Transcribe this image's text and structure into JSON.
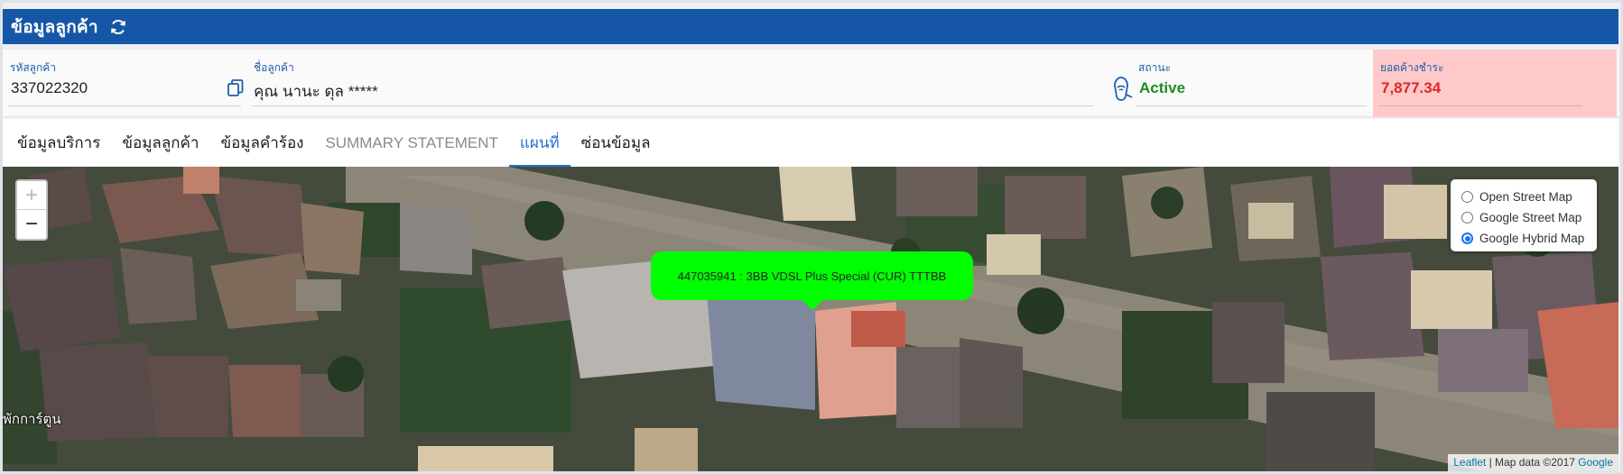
{
  "header": {
    "title": "ข้อมูลลูกค้า",
    "refresh_icon": "refresh-icon"
  },
  "customer": {
    "id_label": "รหัสลูกค้า",
    "id_value": "337022320",
    "name_label": "ชื่อลูกค้า",
    "name_value": "คุณ นานะ ดุล *****",
    "status_label": "สถานะ",
    "status_value": "Active",
    "balance_label": "ยอดค้างชำระ",
    "balance_value": "7,877.34"
  },
  "tabs": [
    {
      "label": "ข้อมูลบริการ",
      "state": "normal"
    },
    {
      "label": "ข้อมูลลูกค้า",
      "state": "normal"
    },
    {
      "label": "ข้อมูลคำร้อง",
      "state": "normal"
    },
    {
      "label": "SUMMARY STATEMENT",
      "state": "muted"
    },
    {
      "label": "แผนที่",
      "state": "active"
    },
    {
      "label": "ซ่อนข้อมูล",
      "state": "normal"
    }
  ],
  "map": {
    "zoom_in": "+",
    "zoom_out": "−",
    "layers": [
      {
        "label": "Open Street Map",
        "selected": false
      },
      {
        "label": "Google Street Map",
        "selected": false
      },
      {
        "label": "Google Hybrid Map",
        "selected": true
      }
    ],
    "popup_text": "447035941 : 3BB VDSL Plus Special (CUR) TTTBB",
    "place_label": "พักการ์ตูน",
    "attribution": {
      "leaflet": "Leaflet",
      "separator": " | Map data ©2017 ",
      "google": "Google"
    }
  },
  "colors": {
    "header_bg": "#1557a6",
    "status_active": "#1e8c1e",
    "balance_text": "#e02424",
    "balance_bg": "#ffc9c9",
    "tab_active": "#1f6fd1",
    "popup_bg": "#00ff00"
  }
}
